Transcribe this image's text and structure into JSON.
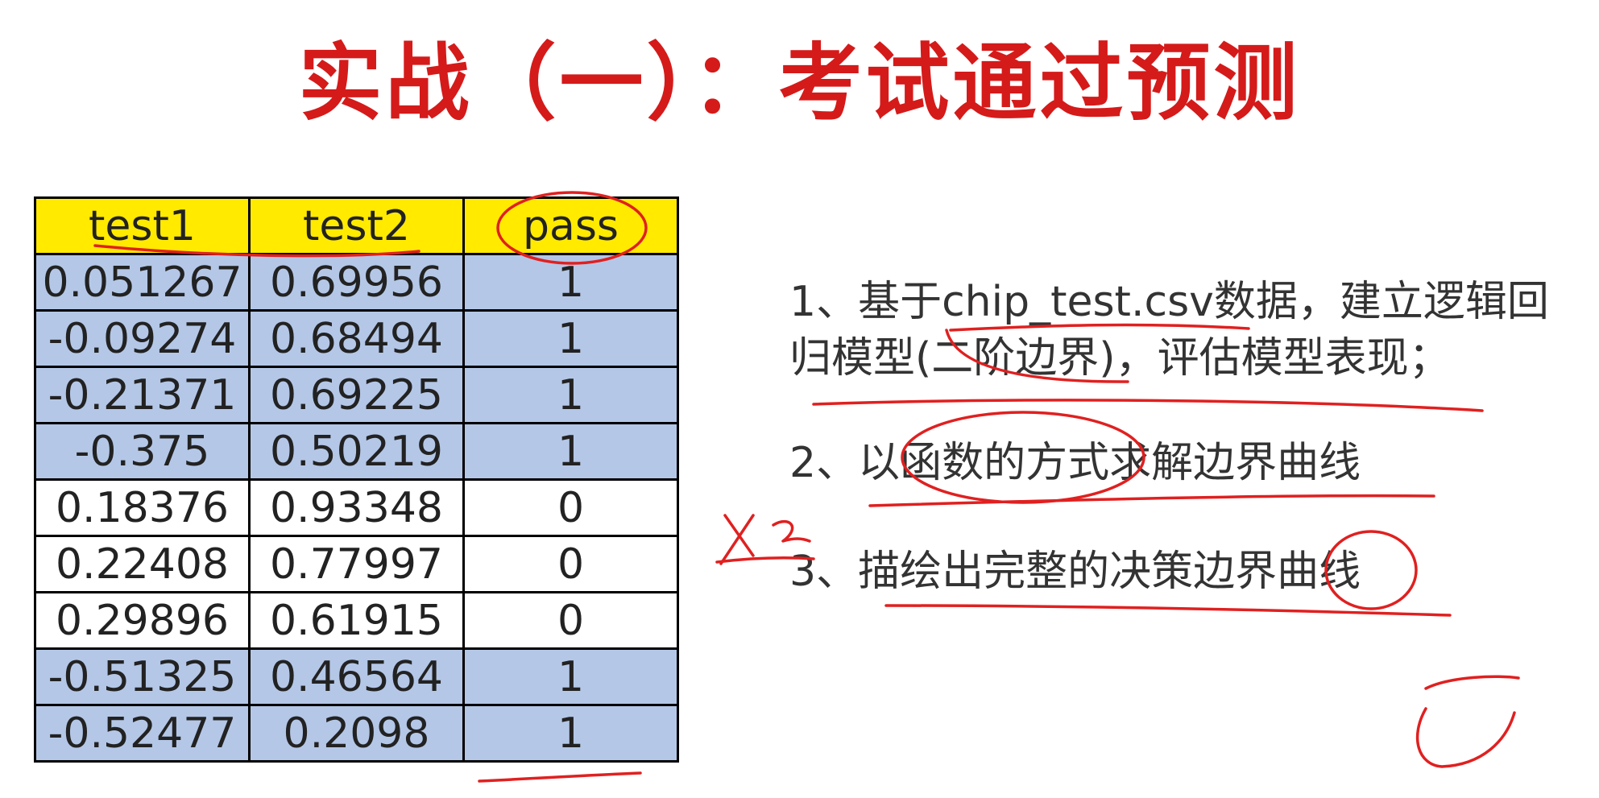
{
  "title": "实战（一）：考试通过预测",
  "table": {
    "headers": [
      "test1",
      "test2",
      "pass"
    ],
    "rows": [
      [
        "0.051267",
        "0.69956",
        "1"
      ],
      [
        "-0.09274",
        "0.68494",
        "1"
      ],
      [
        "-0.21371",
        "0.69225",
        "1"
      ],
      [
        "-0.375",
        "0.50219",
        "1"
      ],
      [
        "0.18376",
        "0.93348",
        "0"
      ],
      [
        "0.22408",
        "0.77997",
        "0"
      ],
      [
        "0.29896",
        "0.61915",
        "0"
      ],
      [
        "-0.51325",
        "0.46564",
        "1"
      ],
      [
        "-0.52477",
        "0.2098",
        "1"
      ]
    ]
  },
  "tasks": [
    "1、基于chip_test.csv数据，建立逻辑回归模型(二阶边界)，评估模型表现；",
    "2、以函数的方式求解边界曲线",
    "3、描绘出完整的决策边界曲线"
  ],
  "annotations": {
    "handwritten_note": "X2",
    "highlight_color": "#e02020"
  }
}
